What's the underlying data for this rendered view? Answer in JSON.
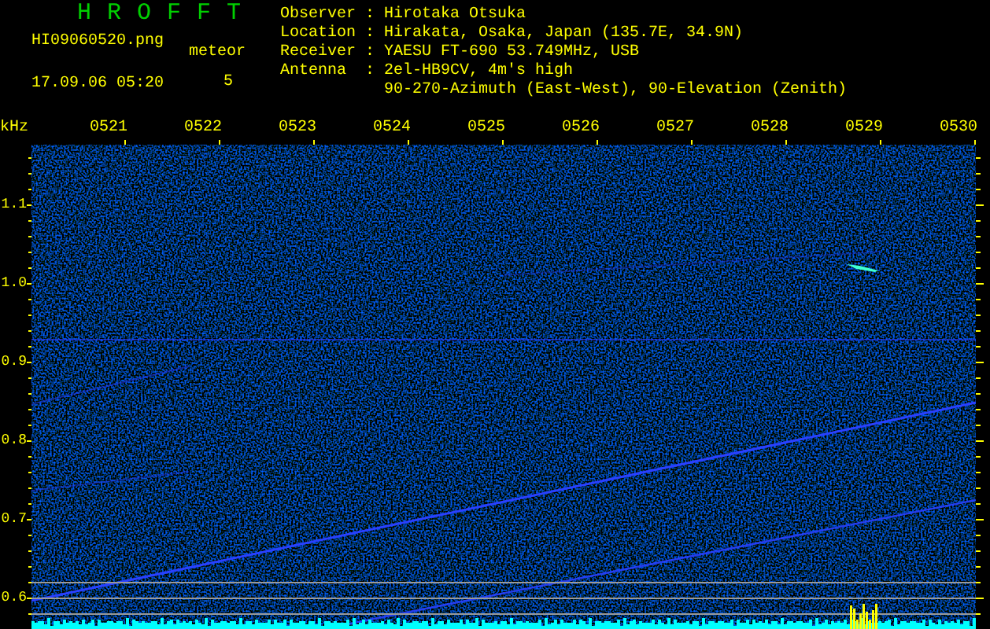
{
  "app_title": "H R O F F T",
  "file": {
    "name": "HI09060520.png",
    "datetime": "17.09.06 05:20"
  },
  "meteor": {
    "label": "meteor",
    "count": "5"
  },
  "info": [
    {
      "key": "Observer",
      "separator": ":",
      "lines": [
        "Hirotaka Otsuka"
      ]
    },
    {
      "key": "Location",
      "separator": ":",
      "lines": [
        "Hirakata, Osaka, Japan (135.7E, 34.9N)"
      ]
    },
    {
      "key": "Receiver",
      "separator": ":",
      "lines": [
        "YAESU FT-690 53.749MHz, USB"
      ]
    },
    {
      "key": "Antenna",
      "separator": ":",
      "lines": [
        "2el-HB9CV, 4m's high",
        "90-270-Azimuth (East-West), 90-Elevation (Zenith)"
      ]
    }
  ],
  "spectrogram": {
    "unit": "kHz",
    "time_labels": [
      "0521",
      "0522",
      "0523",
      "0524",
      "0525",
      "0526",
      "0527",
      "0528",
      "0529",
      "0530"
    ],
    "frequency_labels": [
      "1.1",
      "1.0",
      "0.9",
      "0.8",
      "0.7",
      "0.6"
    ]
  }
}
